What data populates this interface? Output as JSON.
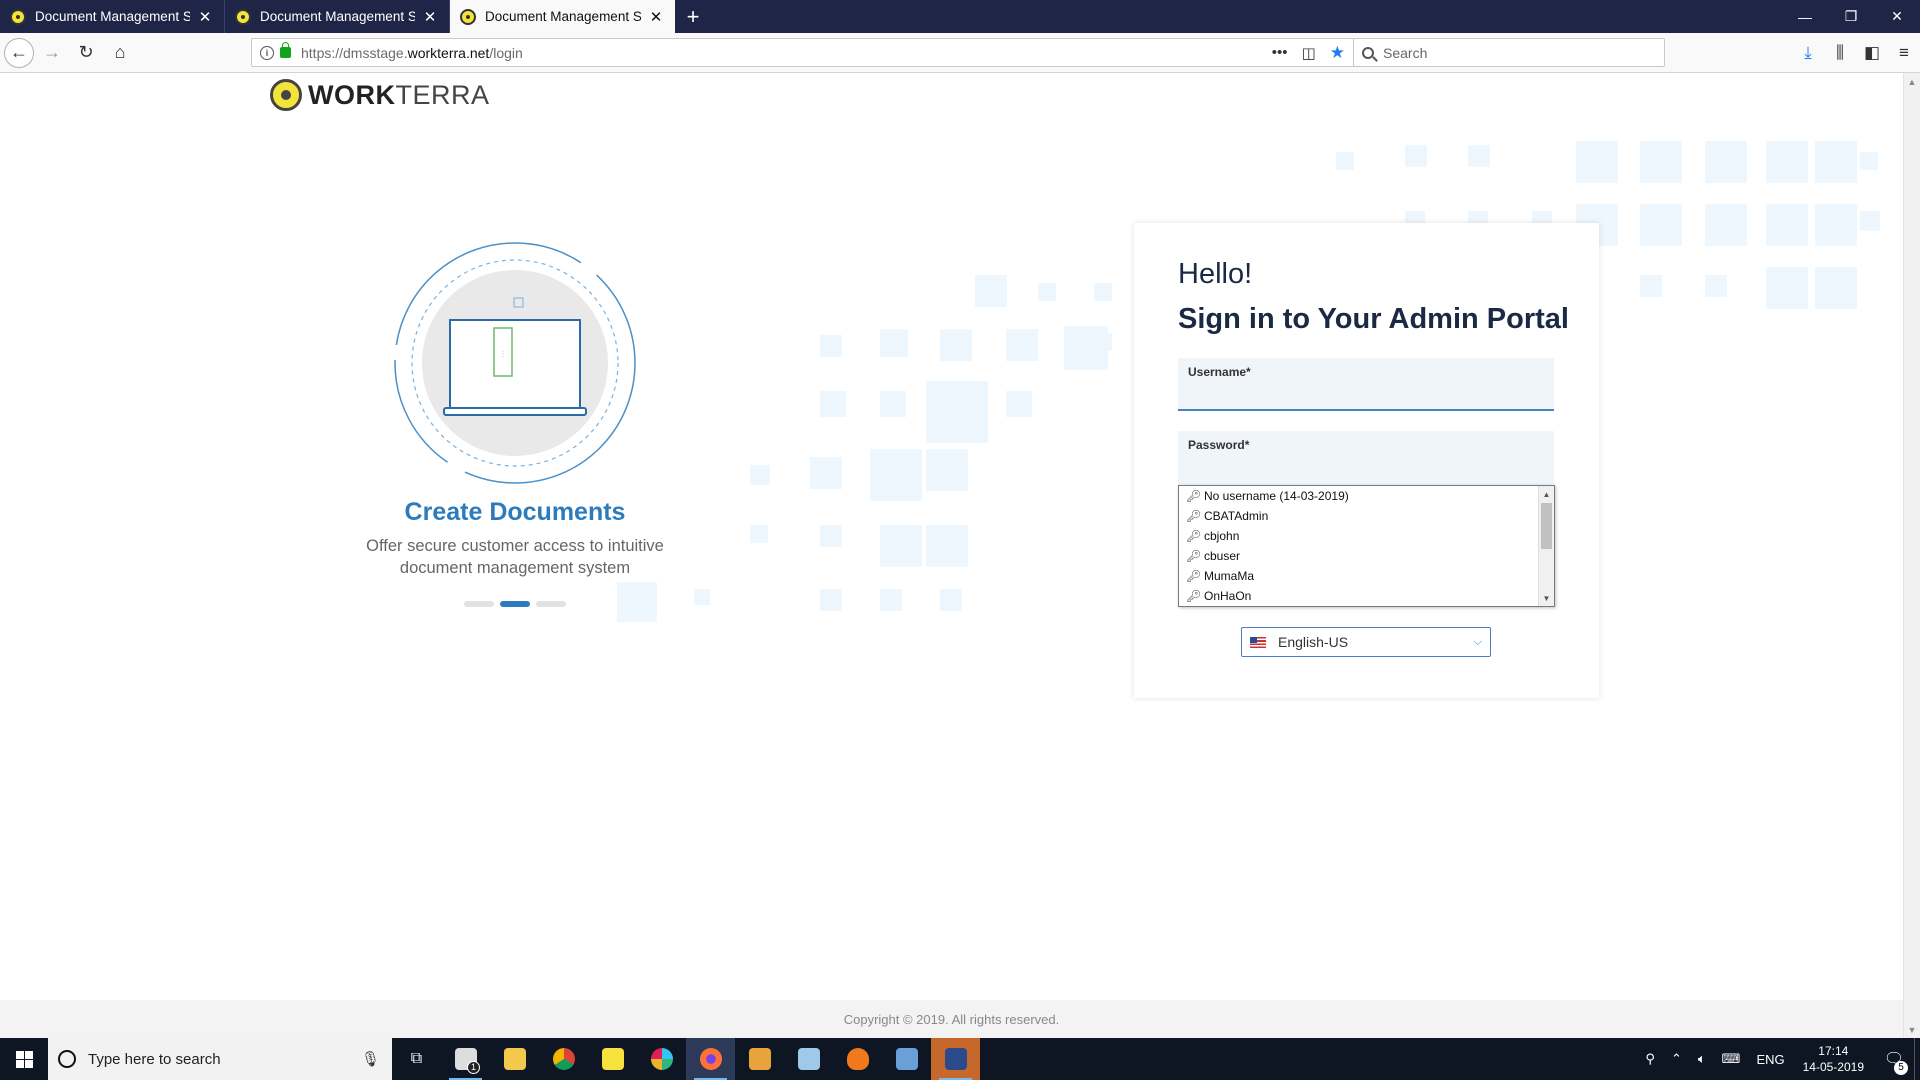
{
  "browser": {
    "tabs": [
      {
        "title": "Document Management Servic"
      },
      {
        "title": "Document Management Servic"
      },
      {
        "title": "Document Management Servic",
        "active": true
      }
    ],
    "url": {
      "prefix": "https://dmsstage.",
      "host": "workterra.net",
      "path": "/login"
    },
    "search_placeholder": "Search"
  },
  "page": {
    "logo": {
      "bold": "WORK",
      "light": "TERRA"
    },
    "carousel": {
      "title": "Create Documents",
      "subtitle": "Offer secure customer access to intuitive document management system",
      "active_slide": 2,
      "slide_count": 3
    },
    "login": {
      "greeting": "Hello!",
      "heading": "Sign in to Your Admin Portal",
      "username_label": "Username*",
      "password_label": "Password*",
      "username_value": "",
      "password_value": ""
    },
    "autocomplete": [
      "No username (14-03-2019)",
      "CBATAdmin",
      "cbjohn",
      "cbuser",
      "MumaMa",
      "OnHaOn"
    ],
    "language": "English-US",
    "footer": "Copyright © 2019. All rights reserved.",
    "colors": {
      "accent": "#2c7bbd",
      "heading": "#1b2a44",
      "tabstrip": "#1e2546"
    }
  },
  "taskbar": {
    "search_placeholder": "Type here to search",
    "language": "ENG",
    "time": "17:14",
    "date": "14-05-2019",
    "notifications": "5",
    "mail_badge": "1"
  }
}
